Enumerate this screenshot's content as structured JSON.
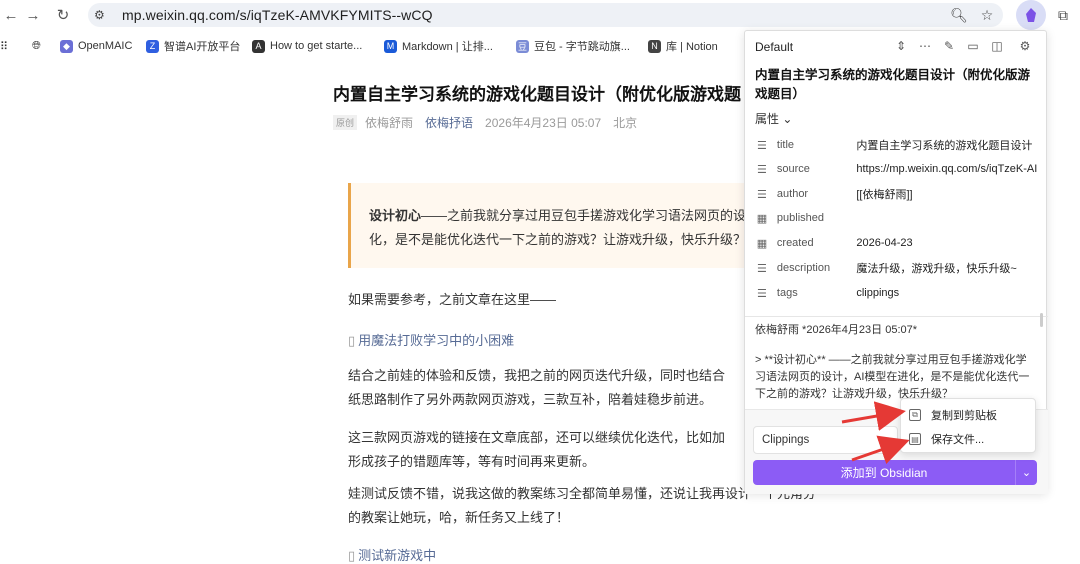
{
  "browser": {
    "url": "mp.weixin.qq.com/s/iqTzeK-AMVKFYMITS--wCQ",
    "bookmarks": [
      {
        "label": "OpenMAIC",
        "icon": "openmaic-icon",
        "color": "#6b6fd6"
      },
      {
        "label": "智谱AI开放平台",
        "icon": "zhipu-icon",
        "color": "#2f5fe0"
      },
      {
        "label": "How to get starte...",
        "icon": "anthropic-icon",
        "color": "#333333"
      },
      {
        "label": "Markdown | 让排...",
        "icon": "markdown-icon",
        "color": "#1a5ad8"
      },
      {
        "label": "豆包 - 字节跳动旗...",
        "icon": "doubao-icon",
        "color": "#7b8cd6"
      },
      {
        "label": "库 | Notion",
        "icon": "notion-icon",
        "color": "#444444"
      }
    ]
  },
  "article": {
    "title": "内置自主学习系统的游戏化题目设计（附优化版游戏题",
    "tag": "原创",
    "author": "依梅舒雨",
    "account": "依梅抒语",
    "date": "2026年4月23日 05:07",
    "location": "北京",
    "quote_bold": "设计初心",
    "quote_rest1": "——之前我就分享过用豆包手搓游戏化学习语法网页的设计，",
    "quote_line2": "化，是不是能优化迭代一下之前的游戏？让游戏升级，快乐升级？",
    "p1": "如果需要参考，之前文章在这里——",
    "link1": "用魔法打败学习中的小困难",
    "p2_l1": "结合之前娃的体验和反馈，我把之前的网页迭代升级，同时也结合",
    "p2_l2": "纸思路制作了另外两款网页游戏，三款互补，陪着娃稳步前进。",
    "p3_l1": "这三款网页游戏的链接在文章底部，还可以继续优化迭代，比如加",
    "p3_l2": "形成孩子的错题库等，等有时间再来更新。",
    "p4_l1": "娃测试反馈不错，说我这做的教案练习全都简单易懂，还说让我再设计一个元角分",
    "p4_l2": "的教案让她玩，哈，新任务又上线了！",
    "link2": "测试新游戏中"
  },
  "clipper": {
    "template": "Default",
    "title": "内置自主学习系统的游戏化题目设计（附优化版游戏题目）",
    "properties_label": "属性",
    "properties": [
      {
        "key": "title",
        "value": "内置自主学习系统的游戏化题目设计",
        "icon": "text-lines-icon"
      },
      {
        "key": "source",
        "value": "https://mp.weixin.qq.com/s/iqTzeK-AI",
        "icon": "text-lines-icon"
      },
      {
        "key": "author",
        "value": "[[依梅舒雨]]",
        "icon": "text-lines-icon"
      },
      {
        "key": "published",
        "value": "",
        "icon": "calendar-icon"
      },
      {
        "key": "created",
        "value": "2026-04-23",
        "icon": "calendar-icon"
      },
      {
        "key": "description",
        "value": "魔法升级，游戏升级，快乐升级~",
        "icon": "text-lines-icon"
      },
      {
        "key": "tags",
        "value": "clippings",
        "icon": "text-lines-icon"
      }
    ],
    "body_line1": "依梅舒雨 *2026年4月23日 05:07*",
    "body_quote": "> **设计初心** ——之前我就分享过用豆包手搓游戏化学习语法网页的设计，AI模型在进化，是不是能优化迭代一下之前的游戏？让游戏升级，快乐升级？",
    "vault": "Clippings",
    "add_button": "添加到 Obsidian",
    "menu": {
      "copy": "复制到剪贴板",
      "save": "保存文件..."
    }
  },
  "colors": {
    "accent": "#8c5cf5",
    "link": "#576b95",
    "quote_border": "#e9a54a",
    "arrow": "#e53935"
  }
}
